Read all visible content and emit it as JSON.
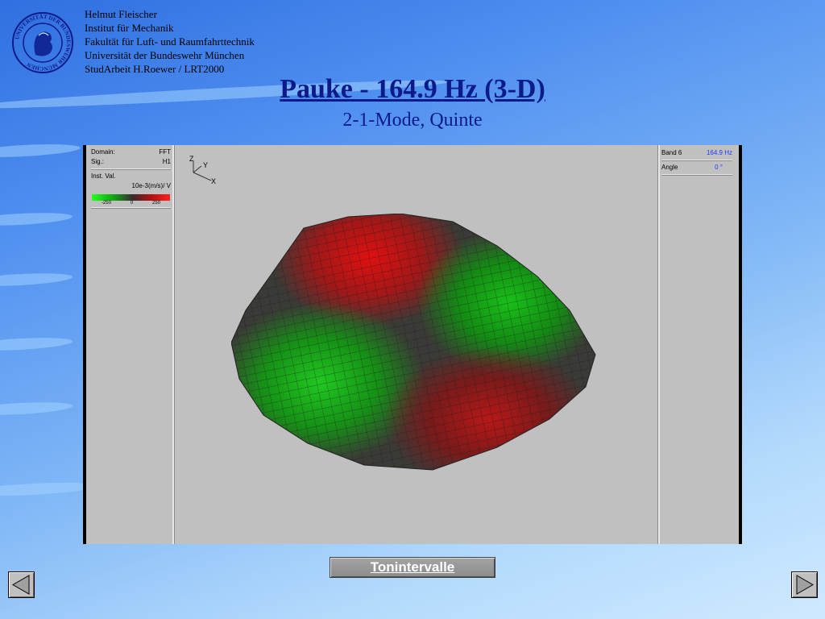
{
  "header": {
    "lines": [
      "Helmut Fleischer",
      "Institut für Mechanik",
      "Fakultät für Luft- und Raumfahrttechnik",
      "Universität der Bundeswehr München",
      "StudArbeit H.Roewer / LRT2000"
    ],
    "seal_text": "UNIVERSITÄT DER BUNDESWEHR MÜNCHEN"
  },
  "title": "Pauke - 164.9 Hz (3-D)",
  "subtitle": "2-1-Mode, Quinte",
  "viewer": {
    "left_panel": {
      "domain_label": "Domain:",
      "domain_value": "FFT",
      "sig_label": "Sig.:",
      "sig_value": "H1",
      "inst_label": "Inst. Val.",
      "unit": "10e-3(m/s)/ V",
      "ticks": [
        "-250",
        "0",
        "250"
      ]
    },
    "right_panel": {
      "band_label": "Band 6",
      "band_value": "164.9 Hz",
      "angle_label": "Angle",
      "angle_value": "0 °"
    },
    "axes": {
      "z": "Z",
      "y": "Y",
      "x": "X"
    },
    "colors": {
      "positive": "#d01010",
      "negative": "#10b010",
      "band_value": "#1a3cff"
    }
  },
  "button": {
    "label": "Tonintervalle"
  },
  "nav": {
    "prev_icon": "triangle-left-icon",
    "next_icon": "triangle-right-icon"
  }
}
